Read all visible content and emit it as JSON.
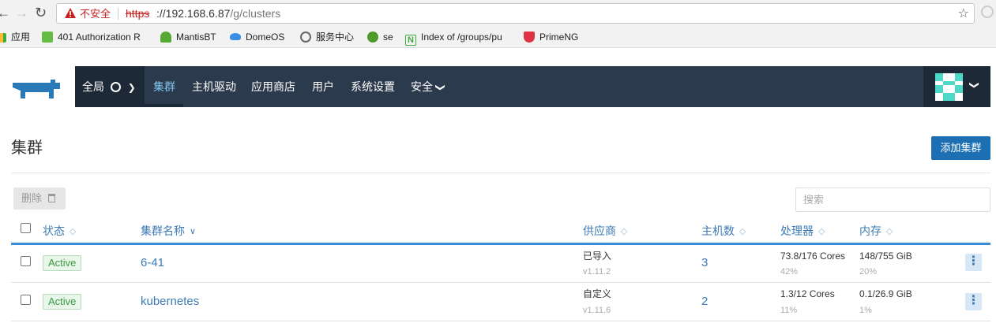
{
  "browser": {
    "insecure_label": "不安全",
    "url_scheme": "https",
    "url_host": "://192.168.6.87",
    "url_path": "/g/clusters"
  },
  "bookmarks": [
    {
      "label": "应用",
      "icon": "apps-grid-icon"
    },
    {
      "label": "401 Authorization R",
      "icon": "site-icon"
    },
    {
      "label": "MantisBT",
      "icon": "mantis-icon"
    },
    {
      "label": "DomeOS",
      "icon": "cloud-icon"
    },
    {
      "label": "服务中心",
      "icon": "gear-icon"
    },
    {
      "label": "se",
      "icon": "globe-icon"
    },
    {
      "label": "Index of /groups/pu",
      "icon": "n-icon"
    },
    {
      "label": "PrimeNG",
      "icon": "shield-icon"
    }
  ],
  "nav": {
    "global": "全局",
    "items": [
      "集群",
      "主机驱动",
      "应用商店",
      "用户",
      "系统设置",
      "安全"
    ],
    "active_index": 0
  },
  "page": {
    "title": "集群",
    "add_button": "添加集群",
    "delete_button": "删除",
    "search_placeholder": "搜索"
  },
  "table": {
    "headers": {
      "state": "状态",
      "name": "集群名称",
      "provider": "供应商",
      "hosts": "主机数",
      "cpu": "处理器",
      "memory": "内存"
    },
    "rows": [
      {
        "state": "Active",
        "name": "6-41",
        "provider": "已导入",
        "version": "v1.11.2",
        "hosts": "3",
        "cpu": "73.8/176 Cores",
        "cpu_pct": "42%",
        "memory": "148/755 GiB",
        "memory_pct": "20%"
      },
      {
        "state": "Active",
        "name": "kubernetes",
        "provider": "自定义",
        "version": "v1.11.6",
        "hosts": "2",
        "cpu": "1.3/12 Cores",
        "cpu_pct": "11%",
        "memory": "0.1/26.9 GiB",
        "memory_pct": "1%"
      }
    ]
  },
  "colors": {
    "navbar": "#2c3a4d",
    "navbar_dark": "#1e2937",
    "accent": "#1c6fb3",
    "link": "#3d7bb6",
    "active_green": "#3c9b43"
  }
}
